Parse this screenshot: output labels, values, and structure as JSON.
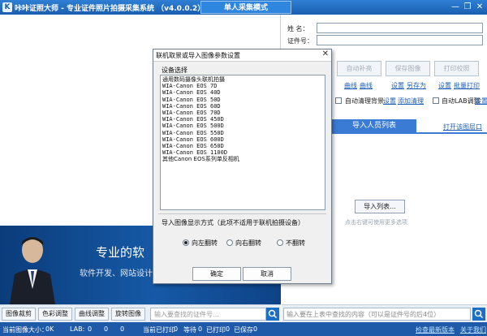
{
  "window": {
    "title": "咔咔证照大师 - 专业证件照片拍摄采集系统 （v4.0.0.2）",
    "mode": "单人采集模式",
    "min_glyph": "—",
    "restore_glyph": "❐",
    "close_glyph": "✕"
  },
  "banner": {
    "title": "专业的软",
    "subtitle": "软件开发、网站设计"
  },
  "left_toolbar": {
    "buttons": [
      "图像裁剪",
      "色彩调整",
      "曲线调整",
      "旋转图像"
    ],
    "search_placeholder": "输入要查找的证件号…"
  },
  "right_panel": {
    "name_label": "姓 名：",
    "id_label": "证件号：",
    "buttons": [
      "自动补亮",
      "保存图像",
      "打印校照"
    ],
    "links_row1": [
      "曲线",
      "曲线"
    ],
    "links_row2": [
      "设置",
      "另存为"
    ],
    "links_row3": [
      "设置",
      "批量打印"
    ],
    "auto_clean_label": "自动清理背景",
    "auto_clean_links": [
      "设置",
      "添加清理"
    ],
    "auto_lab_label": "自动LAB调整",
    "auto_lab_link": "设置",
    "import_tab": "导入人员列表",
    "open_folder_link": "打开该图层口",
    "import_button": "导入列表...",
    "import_hint": "点击右键可使用更多选项",
    "search_placeholder": "输入要在上表中查找的内容（可以是证件号的后4位）"
  },
  "statusbar": {
    "image_size_label": "当前图像大小：",
    "image_size_value": "0K",
    "lab_label": "LAB:",
    "lab_values": [
      "0",
      "0",
      "0"
    ],
    "print_label": "当前已打印",
    "print_value": "0",
    "wait_label": "等待",
    "wait_value": "0",
    "printed_label": "已打印",
    "printed_value": "0",
    "saved_label": "已保存",
    "saved_value": "0",
    "latest_link": "检查最新版本",
    "about_link": "关于我们"
  },
  "dialog": {
    "title": "联机取景或导入图像参数设置",
    "device_label": "设备选择",
    "devices": [
      "通用数码摄像头联机拍摄",
      "WIA-Canon EOS 7D",
      "WIA-Canon EOS 40D",
      "WIA-Canon EOS 50D",
      "WIA-Canon EOS 60D",
      "WIA-Canon EOS 70D",
      "WIA-Canon EOS 450D",
      "WIA-Canon EOS 500D",
      "WIA-Canon EOS 550D",
      "WIA-Canon EOS 600D",
      "WIA-Canon EOS 650D",
      "WIA-Canon EOS 1100D",
      "其他Canon EOS系列单反相机"
    ],
    "display_label": "导入图像显示方式（此项不适用于联机拍摄设备）",
    "radios": [
      {
        "label": "向左翻转",
        "checked": true
      },
      {
        "label": "向右翻转",
        "checked": false
      },
      {
        "label": "不翻转",
        "checked": false
      }
    ],
    "ok": "确定",
    "cancel": "取消"
  }
}
